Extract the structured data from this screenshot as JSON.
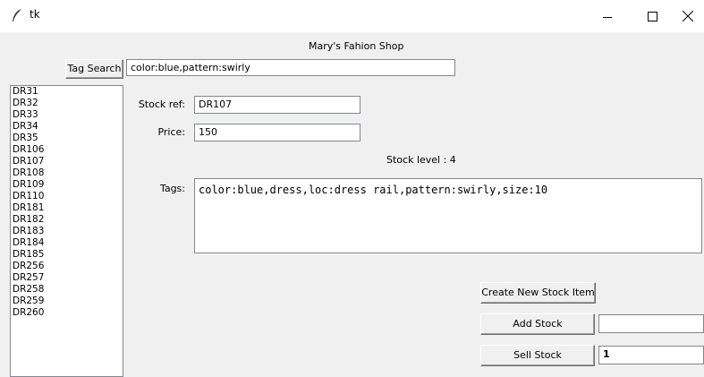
{
  "window": {
    "title": "tk",
    "icons": {
      "app": "feather-icon",
      "minimize": "minimize-icon",
      "maximize": "maximize-icon",
      "close": "close-icon"
    }
  },
  "header": {
    "shop_title": "Mary's Fahion Shop"
  },
  "search": {
    "button_label": "Tag Search",
    "value": "color:blue,pattern:swirly"
  },
  "stock_list": {
    "items": [
      "DR31",
      "DR32",
      "DR33",
      "DR34",
      "DR35",
      "DR106",
      "DR107",
      "DR108",
      "DR109",
      "DR110",
      "DR181",
      "DR182",
      "DR183",
      "DR184",
      "DR185",
      "DR256",
      "DR257",
      "DR258",
      "DR259",
      "DR260"
    ]
  },
  "form": {
    "stock_ref_label": "Stock ref:",
    "stock_ref_value": "DR107",
    "price_label": "Price:",
    "price_value": "150",
    "stock_level_text": "Stock level : 4",
    "tags_label": "Tags:",
    "tags_value": "color:blue,dress,loc:dress rail,pattern:swirly,size:10"
  },
  "actions": {
    "create_label": "Create New Stock Item",
    "add_label": "Add Stock",
    "add_quantity": "",
    "sell_label": "Sell Stock",
    "sell_quantity": "1"
  }
}
